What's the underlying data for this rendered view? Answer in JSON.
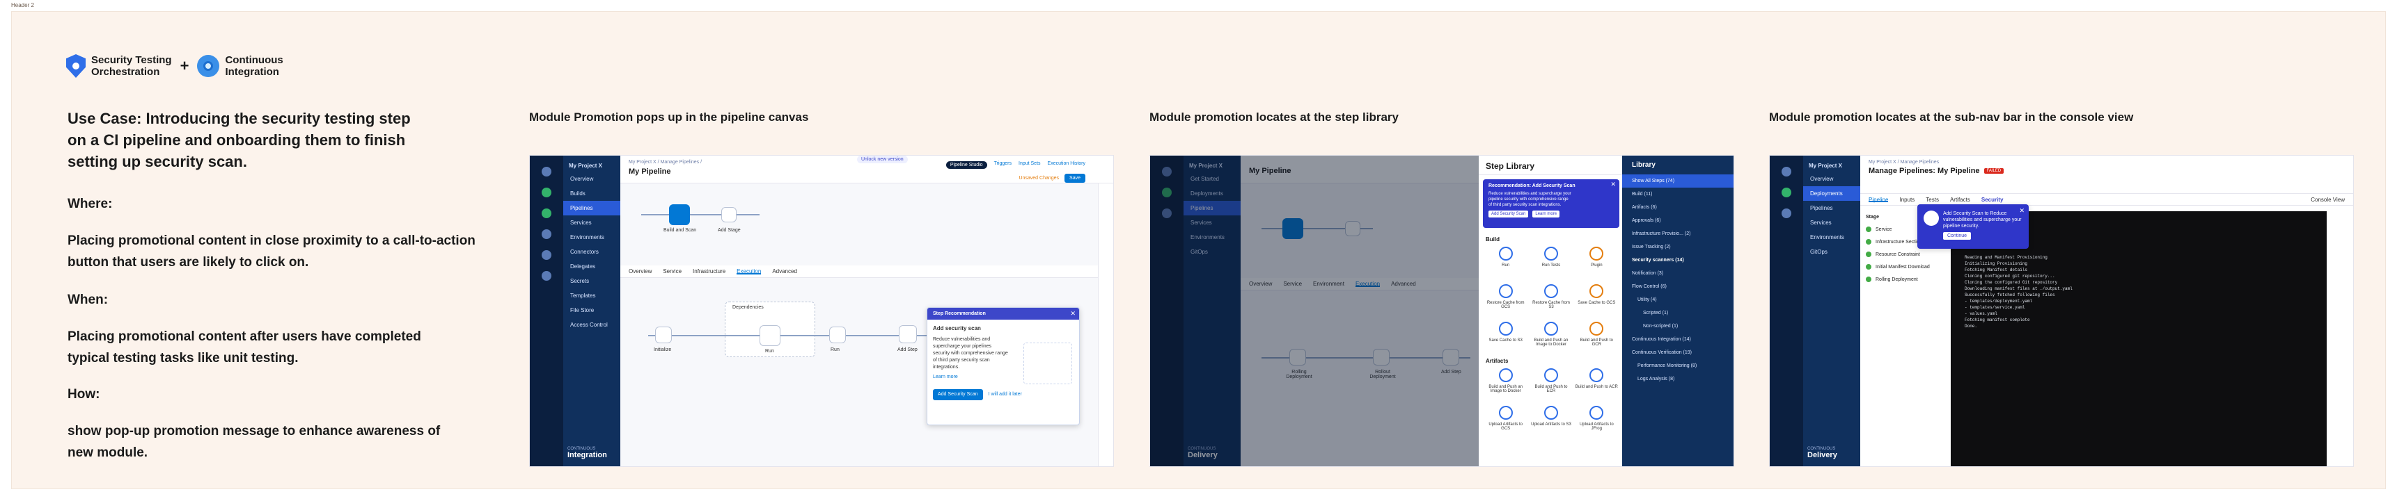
{
  "frame_label": "Header 2",
  "brand": {
    "product1": "Security Testing Orchestration",
    "product1_line1": "Security Testing",
    "product1_line2": "Orchestration",
    "plus": "+",
    "product2_line1": "Continuous",
    "product2_line2": "Integration"
  },
  "left": {
    "title_line1": "Use Case: Introducing the security testing step",
    "title_line2": "on a CI pipeline and onboarding them to finish",
    "title_line3": "setting up security scan.",
    "where_h": "Where:",
    "where_l1": "Placing promotional content in close proximity to a call-to-action",
    "where_l2": "button that users are likely to click on.",
    "when_h": "When:",
    "when_l1": "Placing promotional content after users have completed",
    "when_l2": "typical testing tasks like unit testing.",
    "how_h": "How:",
    "how_l1": "show pop-up promotion message to enhance awareness of",
    "how_l2": "new module."
  },
  "sections": {
    "s1": "Module Promotion pops up in the pipeline canvas",
    "s2": "Module promotion locates at the step library",
    "s3": "Module promotion locates at the sub-nav bar in the console view"
  },
  "shot1": {
    "project": "My Project X",
    "nav": [
      "Overview",
      "Builds",
      "Pipelines",
      "Services",
      "Environments",
      "Connectors",
      "Delegates",
      "Secrets",
      "Templates",
      "File Store",
      "Access Control"
    ],
    "active_nav": "Pipelines",
    "product": "Integration",
    "product_caption": "CONTINUOUS",
    "breadcrumb": "My Project X  /  Manage Pipelines  /",
    "title": "My Pipeline",
    "top_chip": "Unlock new version",
    "view_tabs": [
      "Pipeline Studio",
      "Triggers",
      "Input Sets",
      "Execution History"
    ],
    "save": "Save",
    "unsaved": "Unsaved Changes",
    "stage_label": "Build and Scan",
    "add_stage": "Add Stage",
    "tabs": [
      "Overview",
      "Service",
      "Infrastructure",
      "Execution",
      "Advanced"
    ],
    "active_tab": "Execution",
    "dependencies": "Dependencies",
    "step_labels": [
      "Initialize",
      "Run",
      "Run"
    ],
    "add_step": "Add Step",
    "popup_head": "Step Recommendation",
    "popup_title": "Add security scan",
    "popup_body": "Reduce vulnerabilities and supercharge your pipelines security with comprehensive range of third party security scan integrations.",
    "popup_link": "Learn more",
    "popup_btn": "Add Security Scan",
    "popup_dismiss": "I will add it later"
  },
  "shot2": {
    "project": "My Project X",
    "nav": [
      "Get Started",
      "Deployments",
      "Pipelines",
      "Services",
      "Environments",
      "GitOps"
    ],
    "product": "Delivery",
    "product_caption": "CONTINUOUS",
    "title": "My Pipeline",
    "library_title": "Step Library",
    "rec_head": "Recommendation: Add Security Scan",
    "rec_body": "Reduce vulnerabilities and supercharge your pipeline security with comprehensive range of third party security scan integrations.",
    "rec_btn": "Add Security Scan",
    "rec_link": "Learn more",
    "section_build": "Build",
    "build_tiles": [
      "Run",
      "Run Tests",
      "Plugin",
      "Restore Cache from GCS",
      "Restore Cache from S3",
      "Save Cache to GCS",
      "Save Cache to S3",
      "Build and Push an Image to Docker",
      "Build and Push to GCR"
    ],
    "section_artifacts": "Artifacts",
    "artifact_tiles": [
      "Build and Push an Image to Docker",
      "Build and Push to ECR",
      "Build and Push to ACR",
      "Upload Artifacts to GCS",
      "Upload Artifacts to S3",
      "Upload Artifacts to JFrog"
    ],
    "categories_title": "Library",
    "categories": [
      "Show All Steps (74)",
      "Build (11)",
      "Artifacts (6)",
      "Approvals (6)",
      "Infrastructure Provisio... (2)",
      "Issue Tracking (2)",
      "Security scanners (14)",
      "Notification (3)",
      "Flow Control (6)",
      "Utility (4)",
      "Scripted (1)",
      "Non-scripted (1)",
      "Continuous Integration (14)",
      "Continuous Verification (19)",
      "Performance Monitoring (8)",
      "Logs Analysis (8)"
    ],
    "tabs": [
      "Overview",
      "Service",
      "Environment",
      "Execution",
      "Advanced"
    ],
    "step_labels": [
      "Rolling Deployment",
      "Rollout Deployment"
    ],
    "add_step": "Add Step"
  },
  "shot3": {
    "project": "My Project X",
    "nav": [
      "Overview",
      "Deployments",
      "Pipelines",
      "Services",
      "Environments",
      "GitOps"
    ],
    "product": "Delivery",
    "product_caption": "CONTINUOUS",
    "breadcrumb": "My Project X  /  Manage Pipelines",
    "title": "Manage Pipelines: My Pipeline",
    "status_badge": "FAILED",
    "subtabs": [
      "Pipeline",
      "Inputs",
      "Tests",
      "Artifacts",
      "Security"
    ],
    "console_view": "Console View",
    "stage_header": "Stage",
    "stages": [
      "Service",
      "Infrastructure Section",
      "Resource Constraint",
      "Initial Manifest Download",
      "Rolling Deployment"
    ],
    "popup_body": "Add Security Scan to Reduce vulnerabilities and supercharge your pipeline security.",
    "popup_btn": "Continue",
    "console_lines": [
      "Reading and Manifest Provisioning",
      "Initializing Provisioning",
      "Fetching Manifest details",
      "Cloning configured git repository...",
      "Cloning the configured Git repository",
      "Downloading manifest files at ./output.yaml",
      "Successfully fetched following files",
      "- templates/deployment.yaml",
      "- templates/service.yaml",
      "- values.yaml",
      "Fetching manifest complete",
      "Done."
    ]
  }
}
